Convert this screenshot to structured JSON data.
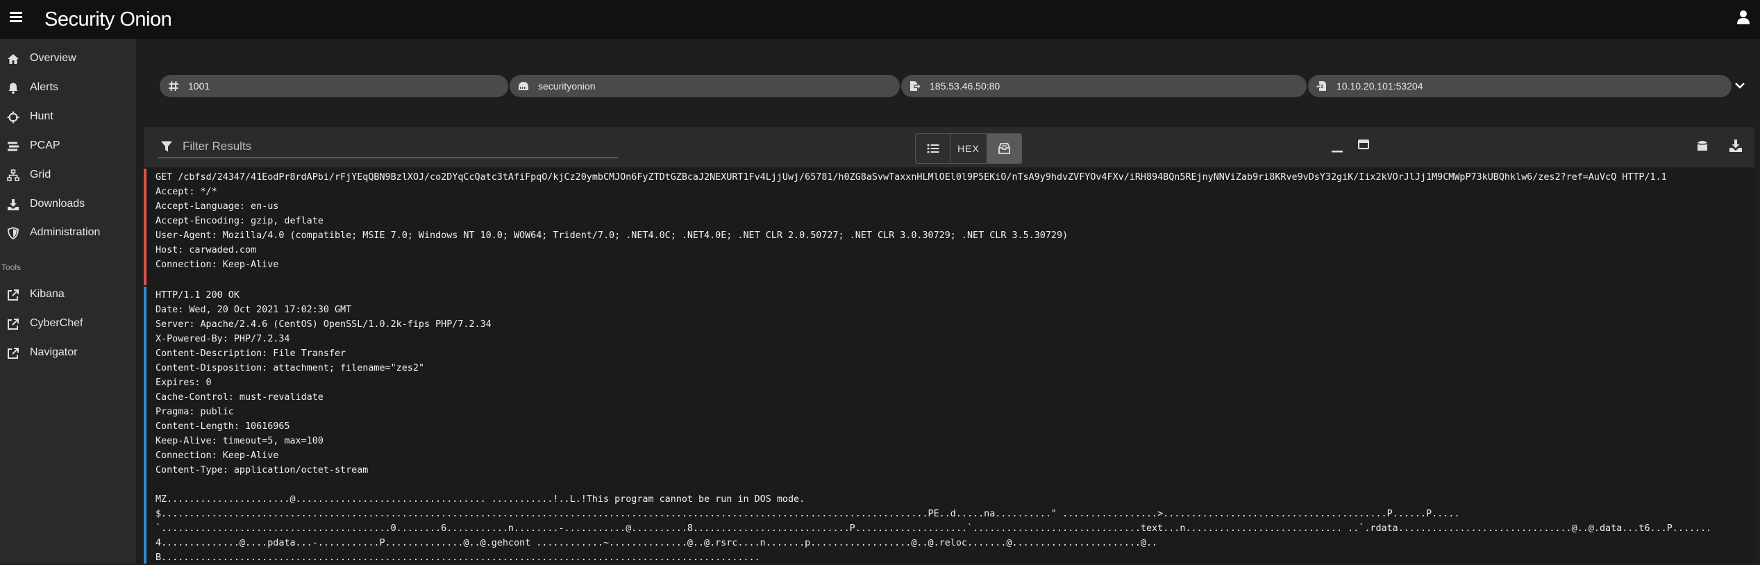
{
  "app": {
    "logo_text": "Security Onion"
  },
  "sidebar": {
    "items": [
      {
        "label": "Overview",
        "icon": "home-icon"
      },
      {
        "label": "Alerts",
        "icon": "bell-icon"
      },
      {
        "label": "Hunt",
        "icon": "crosshairs-icon"
      },
      {
        "label": "PCAP",
        "icon": "stream-icon"
      },
      {
        "label": "Grid",
        "icon": "sitemap-icon"
      },
      {
        "label": "Downloads",
        "icon": "download-icon"
      },
      {
        "label": "Administration",
        "icon": "shield-icon"
      }
    ],
    "tools_heading": "Tools",
    "tools": [
      {
        "label": "Kibana",
        "icon": "external-link-icon"
      },
      {
        "label": "CyberChef",
        "icon": "external-link-icon"
      },
      {
        "label": "Navigator",
        "icon": "external-link-icon"
      }
    ]
  },
  "filters": {
    "chips": [
      {
        "label": "1001",
        "icon": "hashtag-icon"
      },
      {
        "label": "securityonion",
        "icon": "server-icon"
      },
      {
        "label": "185.53.46.50:80",
        "icon": "file-export-icon"
      },
      {
        "label": "10.10.20.101:53204",
        "icon": "file-import-icon"
      }
    ]
  },
  "toolbar": {
    "filter_placeholder": "Filter Results",
    "filter_value": "",
    "hex_label": "HEX",
    "active_view": "transcript"
  },
  "colors": {
    "request_bar": "#d9534f",
    "response_bar": "#2f88d6",
    "chip_bg": "#4a4a4a"
  },
  "transcript": {
    "request": "GET /cbfsd/24347/41EodPr8rdAPbi/rFjYEqQBN9BzlXOJ/co2DYqCcQatc3tAfiFpqO/kjCz20ymbCMJOn6FyZTDtGZBcaJ2NEXURT1Fv4LjjUwj/65781/h0ZG8aSvwTaxxnHLMlOEl0l9P5EKiO/nTsA9y9hdvZVFYOv4FXv/iRH894BQn5REjnyNNViZab9ri8KRve9vDsY32giK/Iix2kVOrJlJj1M9CMWpP73kUBQhklw6/zes2?ref=AuVcQ HTTP/1.1\nAccept: */*\nAccept-Language: en-us\nAccept-Encoding: gzip, deflate\nUser-Agent: Mozilla/4.0 (compatible; MSIE 7.0; Windows NT 10.0; WOW64; Trident/7.0; .NET4.0C; .NET4.0E; .NET CLR 2.0.50727; .NET CLR 3.0.30729; .NET CLR 3.5.30729)\nHost: carwaded.com\nConnection: Keep-Alive",
    "response": "HTTP/1.1 200 OK\nDate: Wed, 20 Oct 2021 17:02:30 GMT\nServer: Apache/2.4.6 (CentOS) OpenSSL/1.0.2k-fips PHP/7.2.34\nX-Powered-By: PHP/7.2.34\nContent-Description: File Transfer\nContent-Disposition: attachment; filename=\"zes2\"\nExpires: 0\nCache-Control: must-revalidate\nPragma: public\nContent-Length: 10616965\nKeep-Alive: timeout=5, max=100\nConnection: Keep-Alive\nContent-Type: application/octet-stream\n\nMZ......................@.................................. ...........!..L.!This program cannot be run in DOS mode.\n$.........................................................................................................................................PE..d.....na..........\" .................>........................................P......P.....\n`.........................................0........6...........n........-...........@..........8............................P....................`..............................text...n............................ ..`.rdata...............................@..@.data...t6...P.......\n4..............@....pdata...-...........P..............@..@.gehcont ............~..............@..@.rsrc....n.......p..................@..@.reloc.......@.......................@..\nB..........................................................................................................."
  }
}
